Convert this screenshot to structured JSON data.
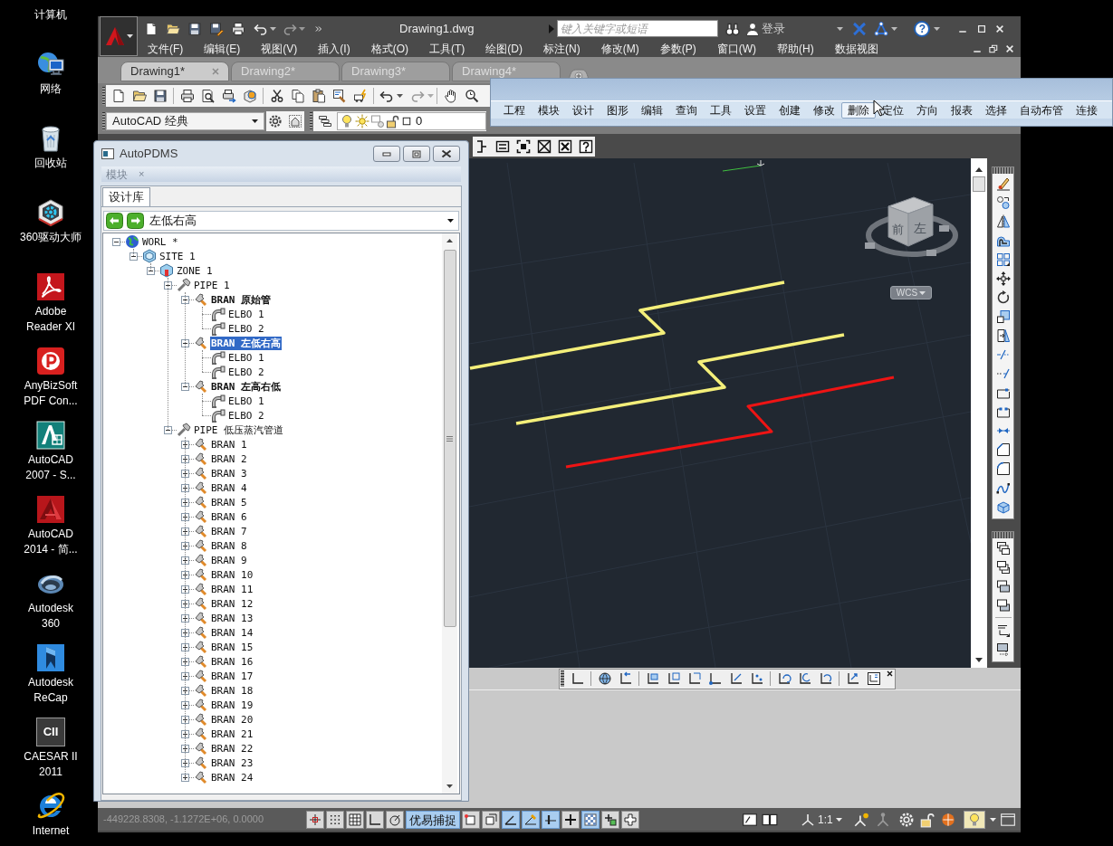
{
  "desktop": {
    "icons": [
      {
        "label": "计算机"
      },
      {
        "kind": "network",
        "label": "网络"
      },
      {
        "kind": "recycle",
        "label": "回收站"
      },
      {
        "kind": "driver",
        "label": "360驱动大师"
      },
      {
        "kind": "reader",
        "label": "Adobe\nReader XI"
      },
      {
        "kind": "converter",
        "label": "AnyBizSoft\nPDF Con..."
      },
      {
        "kind": "cad2007",
        "label": "AutoCAD\n2007 - S..."
      },
      {
        "kind": "cad2014",
        "label": "AutoCAD\n2014 - 简..."
      },
      {
        "kind": "cloud",
        "label": "Autodesk\n360"
      },
      {
        "kind": "recap",
        "label": "Autodesk\nReCap"
      },
      {
        "kind": "caesar",
        "icon_text": "CII",
        "label": "CAESAR II\n2011"
      },
      {
        "kind": "browser",
        "label": "Internet"
      }
    ]
  },
  "cad_window": {
    "title": "Drawing1.dwg",
    "search": {
      "placeholder": "键入关键字或短语"
    },
    "sign_in": "登录",
    "help": "?",
    "menus": [
      "文件(F)",
      "编辑(E)",
      "视图(V)",
      "插入(I)",
      "格式(O)",
      "工具(T)",
      "绘图(D)",
      "标注(N)",
      "修改(M)",
      "参数(P)",
      "窗口(W)",
      "帮助(H)",
      "数据视图"
    ],
    "tabs": [
      {
        "label": "Drawing1*",
        "selected": true
      },
      {
        "label": "Drawing2*",
        "selected": false
      },
      {
        "label": "Drawing3*",
        "selected": false
      },
      {
        "label": "Drawing4*",
        "selected": false
      }
    ],
    "workspace": "AutoCAD 经典",
    "layer": "0",
    "viewcube_faces": [
      "前",
      "左"
    ],
    "wcs": "WCS",
    "coordinates": "-449228.8308, -1.1272E+06, 0.0000",
    "status_toggles": [
      {
        "kind": "infer",
        "on": false
      },
      {
        "kind": "snap",
        "on": false
      },
      {
        "kind": "grid",
        "on": false
      },
      {
        "kind": "ortho",
        "on": false
      },
      {
        "kind": "polar",
        "on": false
      },
      {
        "kind": "text",
        "label": "优易捕捉",
        "on": true
      },
      {
        "kind": "osnap3d",
        "on": false
      },
      {
        "kind": "otrack",
        "on": false
      },
      {
        "kind": "ducs",
        "on": true
      },
      {
        "kind": "dyn",
        "on": true
      },
      {
        "kind": "lwt",
        "on": true
      },
      {
        "kind": "tpy",
        "on": false
      },
      {
        "kind": "qp",
        "on": true
      },
      {
        "kind": "sc",
        "on": false
      },
      {
        "kind": "am",
        "on": false
      }
    ],
    "annotation_scale": "1:1"
  },
  "pdms_menu": {
    "items": [
      {
        "label": "工程",
        "hovered": false
      },
      {
        "label": "模块",
        "hovered": false
      },
      {
        "label": "设计",
        "hovered": false
      },
      {
        "label": "图形",
        "hovered": false
      },
      {
        "label": "编辑",
        "hovered": false
      },
      {
        "label": "查询",
        "hovered": false
      },
      {
        "label": "工具",
        "hovered": false
      },
      {
        "label": "设置",
        "hovered": false
      },
      {
        "label": "创建",
        "hovered": false
      },
      {
        "label": "修改",
        "hovered": false
      },
      {
        "label": "删除",
        "hovered": true
      },
      {
        "label": "定位",
        "hovered": false
      },
      {
        "label": "方向",
        "hovered": false
      },
      {
        "label": "报表",
        "hovered": false
      },
      {
        "label": "选择",
        "hovered": false
      },
      {
        "label": "自动布管",
        "hovered": false
      },
      {
        "label": "连接",
        "hovered": false
      }
    ]
  },
  "pdms_window": {
    "title": "AutoPDMS",
    "module_tab": "模块",
    "module_close": "×",
    "tab": "设计库",
    "selection": "左低右高",
    "tree": [
      {
        "kind": "world",
        "label": "WORL *",
        "expanded": true,
        "selected": false,
        "bold": false,
        "children": [
          {
            "kind": "site",
            "label": "SITE 1",
            "expanded": true,
            "selected": false,
            "bold": false,
            "children": [
              {
                "kind": "zone",
                "label": "ZONE 1",
                "expanded": true,
                "selected": false,
                "bold": false,
                "children": [
                  {
                    "kind": "pipe",
                    "label": "PIPE 1",
                    "expanded": true,
                    "selected": false,
                    "bold": false,
                    "children": [
                      {
                        "kind": "bran",
                        "label": "BRAN 原始管",
                        "expanded": true,
                        "selected": false,
                        "bold": true,
                        "children": [
                          {
                            "kind": "elbo",
                            "label": "ELBO 1",
                            "selected": false,
                            "bold": false
                          },
                          {
                            "kind": "elbo",
                            "label": "ELBO 2",
                            "selected": false,
                            "bold": false
                          }
                        ]
                      },
                      {
                        "kind": "bran",
                        "label": "BRAN 左低右高",
                        "expanded": true,
                        "selected": true,
                        "bold": true,
                        "children": [
                          {
                            "kind": "elbo",
                            "label": "ELBO 1",
                            "selected": false,
                            "bold": false
                          },
                          {
                            "kind": "elbo",
                            "label": "ELBO 2",
                            "selected": false,
                            "bold": false
                          }
                        ]
                      },
                      {
                        "kind": "bran",
                        "label": "BRAN 左高右低",
                        "expanded": true,
                        "selected": false,
                        "bold": true,
                        "children": [
                          {
                            "kind": "elbo",
                            "label": "ELBO 1",
                            "selected": false,
                            "bold": false
                          },
                          {
                            "kind": "elbo",
                            "label": "ELBO 2",
                            "selected": false,
                            "bold": false
                          }
                        ]
                      }
                    ]
                  },
                  {
                    "kind": "pipe",
                    "label": "PIPE 低压蒸汽管道",
                    "expanded": true,
                    "selected": false,
                    "bold": false,
                    "children": [
                      {
                        "kind": "bran",
                        "label": "BRAN 1",
                        "expanded": false,
                        "selected": false,
                        "bold": false
                      },
                      {
                        "kind": "bran",
                        "label": "BRAN 2",
                        "expanded": false,
                        "selected": false,
                        "bold": false
                      },
                      {
                        "kind": "bran",
                        "label": "BRAN 3",
                        "expanded": false,
                        "selected": false,
                        "bold": false
                      },
                      {
                        "kind": "bran",
                        "label": "BRAN 4",
                        "expanded": false,
                        "selected": false,
                        "bold": false
                      },
                      {
                        "kind": "bran",
                        "label": "BRAN 5",
                        "expanded": false,
                        "selected": false,
                        "bold": false
                      },
                      {
                        "kind": "bran",
                        "label": "BRAN 6",
                        "expanded": false,
                        "selected": false,
                        "bold": false
                      },
                      {
                        "kind": "bran",
                        "label": "BRAN 7",
                        "expanded": false,
                        "selected": false,
                        "bold": false
                      },
                      {
                        "kind": "bran",
                        "label": "BRAN 8",
                        "expanded": false,
                        "selected": false,
                        "bold": false
                      },
                      {
                        "kind": "bran",
                        "label": "BRAN 9",
                        "expanded": false,
                        "selected": false,
                        "bold": false
                      },
                      {
                        "kind": "bran",
                        "label": "BRAN 10",
                        "expanded": false,
                        "selected": false,
                        "bold": false
                      },
                      {
                        "kind": "bran",
                        "label": "BRAN 11",
                        "expanded": false,
                        "selected": false,
                        "bold": false
                      },
                      {
                        "kind": "bran",
                        "label": "BRAN 12",
                        "expanded": false,
                        "selected": false,
                        "bold": false
                      },
                      {
                        "kind": "bran",
                        "label": "BRAN 13",
                        "expanded": false,
                        "selected": false,
                        "bold": false
                      },
                      {
                        "kind": "bran",
                        "label": "BRAN 14",
                        "expanded": false,
                        "selected": false,
                        "bold": false
                      },
                      {
                        "kind": "bran",
                        "label": "BRAN 15",
                        "expanded": false,
                        "selected": false,
                        "bold": false
                      },
                      {
                        "kind": "bran",
                        "label": "BRAN 16",
                        "expanded": false,
                        "selected": false,
                        "bold": false
                      },
                      {
                        "kind": "bran",
                        "label": "BRAN 17",
                        "expanded": false,
                        "selected": false,
                        "bold": false
                      },
                      {
                        "kind": "bran",
                        "label": "BRAN 18",
                        "expanded": false,
                        "selected": false,
                        "bold": false
                      },
                      {
                        "kind": "bran",
                        "label": "BRAN 19",
                        "expanded": false,
                        "selected": false,
                        "bold": false
                      },
                      {
                        "kind": "bran",
                        "label": "BRAN 20",
                        "expanded": false,
                        "selected": false,
                        "bold": false
                      },
                      {
                        "kind": "bran",
                        "label": "BRAN 21",
                        "expanded": false,
                        "selected": false,
                        "bold": false
                      },
                      {
                        "kind": "bran",
                        "label": "BRAN 22",
                        "expanded": false,
                        "selected": false,
                        "bold": false
                      },
                      {
                        "kind": "bran",
                        "label": "BRAN 23",
                        "expanded": false,
                        "selected": false,
                        "bold": false
                      },
                      {
                        "kind": "bran",
                        "label": "BRAN 24",
                        "expanded": false,
                        "selected": false,
                        "bold": false
                      }
                    ]
                  }
                ]
              }
            ]
          }
        ]
      }
    ]
  }
}
